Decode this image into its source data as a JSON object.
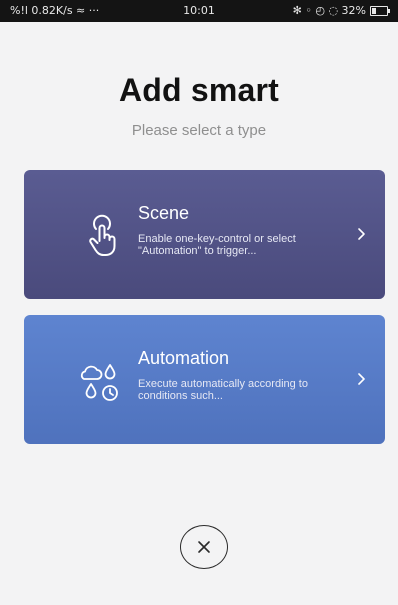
{
  "status_bar": {
    "left": "%!l 0.82K/s ≈ ···",
    "time": "10:01",
    "right": "✻ ◦ ◴ ◌ 32%",
    "battery_level": 0.32
  },
  "header": {
    "title": "Add smart",
    "subtitle": "Please select a type"
  },
  "cards": [
    {
      "title": "Scene",
      "description": "Enable one-key-control or select \"Automation\" to trigger...",
      "icon": "hand-tap-icon",
      "color": "#515387"
    },
    {
      "title": "Automation",
      "description": "Execute automatically according to conditions such...",
      "icon": "weather-clock-icon",
      "color": "#577bc7"
    }
  ],
  "close_icon": "close-icon"
}
